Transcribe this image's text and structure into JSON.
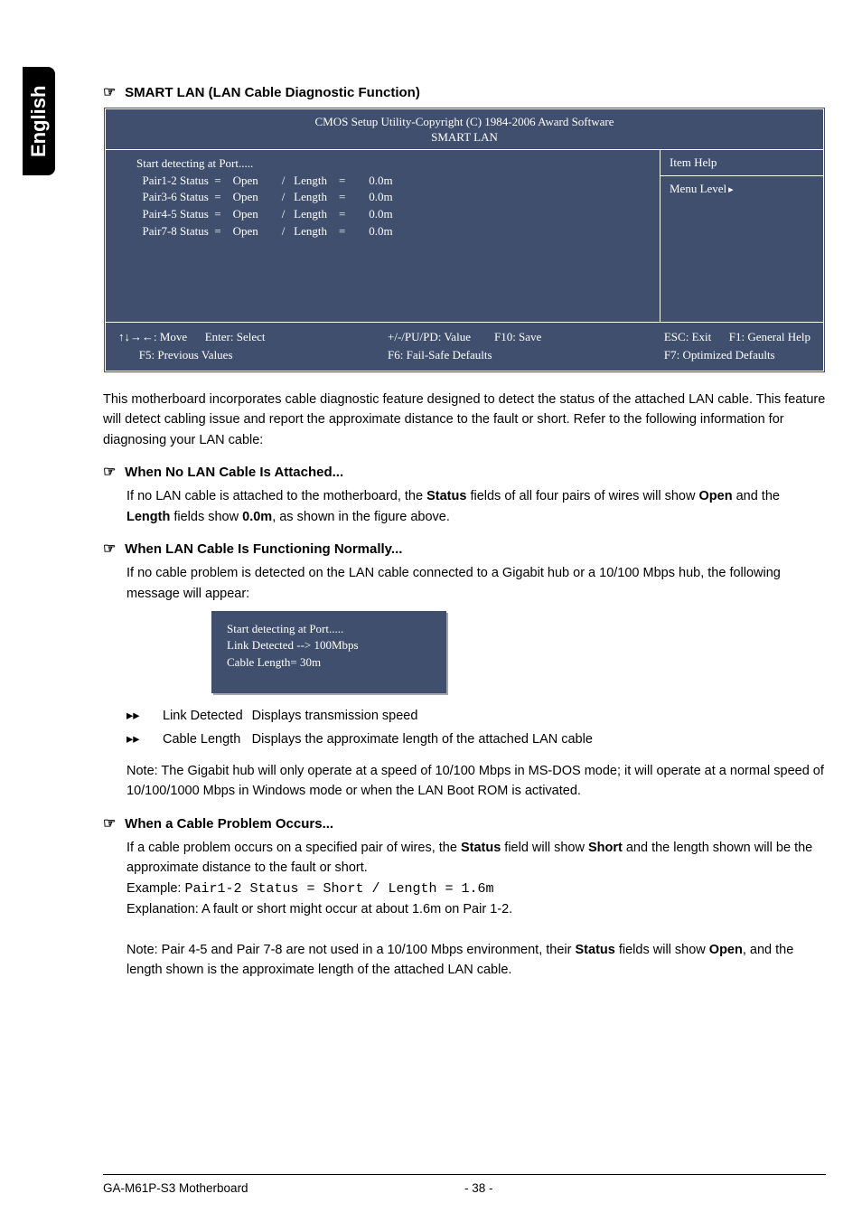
{
  "side_tab": "English",
  "title": "SMART LAN (LAN Cable Diagnostic Function)",
  "bios": {
    "header_line1": "CMOS Setup Utility-Copyright (C) 1984-2006 Award Software",
    "header_line2": "SMART LAN",
    "left_raw": "Start detecting at Port.....\n  Pair1-2 Status  =    Open        /   Length    =        0.0m\n  Pair3-6 Status  =    Open        /   Length    =        0.0m\n  Pair4-5 Status  =    Open        /   Length    =        0.0m\n  Pair7-8 Status  =    Open        /   Length    =        0.0m",
    "right_head": "Item Help",
    "right_body": "Menu Level",
    "footer": {
      "c1a": "↑↓→←: Move",
      "c1b": "Enter: Select",
      "c1c": "+/-/PU/PD: Value",
      "c1d": "F10: Save",
      "c1e": "ESC: Exit",
      "c1f": "F1: General Help",
      "c2a": "F5: Previous Values",
      "c2b": "F6: Fail-Safe Defaults",
      "c2c": "F7: Optimized Defaults"
    }
  },
  "intro": "This motherboard incorporates cable diagnostic feature designed to detect the status of the attached LAN cable.  This feature will detect cabling issue and report the approximate distance to the fault or short. Refer to the following information for diagnosing your LAN cable:",
  "s1": {
    "head": "When No LAN Cable Is Attached...",
    "p1a": "If no LAN cable is attached to the motherboard, the ",
    "p1b": "Status",
    "p1c": " fields of all four pairs of wires will show ",
    "p1d": "Open",
    "p1e": " and the ",
    "p1f": "Length",
    "p1g": " fields show ",
    "p1h": "0.0m",
    "p1i": ",   as shown in the figure above."
  },
  "s2": {
    "head": "When LAN Cable Is Functioning Normally...",
    "p1": "If no cable problem is detected on the LAN cable connected to a Gigabit hub or a 10/100 Mbps hub, the following message will appear:",
    "box_l1": "Start detecting at Port.....",
    "box_l2": "Link Detected --> 100Mbps",
    "box_l3": "Cable Length= 30m",
    "kv": {
      "k1": "Link Detected",
      "v1": "Displays transmission speed",
      "k2": "Cable Length",
      "v2": "Displays the approximate length of the attached LAN cable"
    },
    "note": "Note: The Gigabit hub will only operate at a speed of 10/100 Mbps in MS-DOS mode; it will operate at a normal speed of 10/100/1000 Mbps in Windows mode or when the LAN Boot ROM is activated."
  },
  "s3": {
    "head": "When a Cable Problem Occurs...",
    "p1a": "If a cable problem occurs on a specified pair of wires, the ",
    "p1b": "Status",
    "p1c": " field will show ",
    "p1d": "Short",
    "p1e": " and the length shown will be the approximate distance to the fault or short.",
    "ex_label": "Example: ",
    "ex_code": "Pair1-2 Status = Short / Length  =  1.6m",
    "expl": "Explanation: A fault or short might occur at about 1.6m on Pair 1-2.",
    "note_a": "Note: Pair 4-5 and Pair 7-8 are not used in a 10/100 Mbps environment, their ",
    "note_b": "Status",
    "note_c": " fields will show ",
    "note_d": "Open",
    "note_e": ", and the length shown is the approximate length of the attached LAN cable."
  },
  "footer": {
    "left": "GA-M61P-S3 Motherboard",
    "center": "- 38 -"
  }
}
